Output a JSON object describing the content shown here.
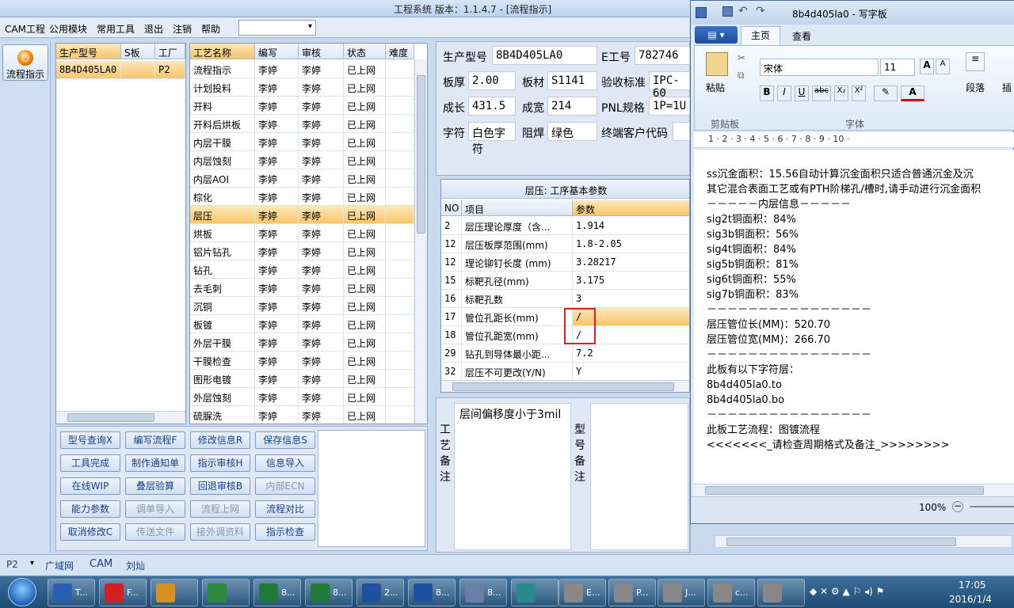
{
  "app": {
    "title": "工程系统  版本：1.1.4.7 - [流程指示]"
  },
  "menu": [
    "CAM工程",
    "公用模块",
    "常用工具",
    "退出",
    "注销",
    "帮助"
  ],
  "left_nav": {
    "button": "流程指示"
  },
  "model_grid": {
    "headers": [
      "生产型号",
      "S板",
      "工厂"
    ],
    "rows": [
      [
        "8B4D405LA0",
        "",
        "P2"
      ]
    ]
  },
  "process_grid": {
    "headers": [
      "工艺名称",
      "编写",
      "审核",
      "状态",
      "难度"
    ],
    "rows": [
      [
        "流程指示",
        "李婷",
        "李婷",
        "已上网"
      ],
      [
        "计划投料",
        "李婷",
        "李婷",
        "已上网"
      ],
      [
        "开料",
        "李婷",
        "李婷",
        "已上网"
      ],
      [
        "开料后烘板",
        "李婷",
        "李婷",
        "已上网"
      ],
      [
        "内层干膜",
        "李婷",
        "李婷",
        "已上网"
      ],
      [
        "内层蚀刻",
        "李婷",
        "李婷",
        "已上网"
      ],
      [
        "内层AOI",
        "李婷",
        "李婷",
        "已上网"
      ],
      [
        "棕化",
        "李婷",
        "李婷",
        "已上网"
      ],
      [
        "层压",
        "李婷",
        "李婷",
        "已上网"
      ],
      [
        "烘板",
        "李婷",
        "李婷",
        "已上网"
      ],
      [
        "铝片钻孔",
        "李婷",
        "李婷",
        "已上网"
      ],
      [
        "钻孔",
        "李婷",
        "李婷",
        "已上网"
      ],
      [
        "去毛刺",
        "李婷",
        "李婷",
        "已上网"
      ],
      [
        "沉铜",
        "李婷",
        "李婷",
        "已上网"
      ],
      [
        "板镀",
        "李婷",
        "李婷",
        "已上网"
      ],
      [
        "外层干膜",
        "李婷",
        "李婷",
        "已上网"
      ],
      [
        "干膜检查",
        "李婷",
        "李婷",
        "已上网"
      ],
      [
        "图形电镀",
        "李婷",
        "李婷",
        "已上网"
      ],
      [
        "外层蚀刻",
        "李婷",
        "李婷",
        "已上网"
      ],
      [
        "硫脲洗",
        "李婷",
        "李婷",
        "已上网"
      ]
    ],
    "selected": 8
  },
  "info": {
    "model_label": "生产型号",
    "model": "8B4D405LA0",
    "eno_label": "E工号",
    "eno": "782746",
    "thick_label": "板厚",
    "thick": "2.00",
    "material_label": "板材",
    "material": "S1141",
    "std_label": "验收标准",
    "std": "IPC-60",
    "len_label": "成长",
    "len": "431.5",
    "wid_label": "成宽",
    "wid": "214",
    "pnl_label": "PNL规格",
    "pnl": "1P=1U",
    "char_label": "字符",
    "char": "白色字符",
    "mask_label": "阻焊",
    "mask": "绿色",
    "cust_label": "终端客户代码",
    "cust": ""
  },
  "params": {
    "title": "层压: 工序基本参数",
    "headers": [
      "NO",
      "项目",
      "参数"
    ],
    "rows": [
      [
        "2",
        "层压理论厚度（含...",
        "1.914"
      ],
      [
        "12",
        "层压板厚范围(mm)",
        "1.8-2.05"
      ],
      [
        "12",
        "理论铆钉长度 (mm)",
        "3.28217"
      ],
      [
        "15",
        "标靶孔径(mm)",
        "3.175"
      ],
      [
        "16",
        "标靶孔数",
        "3"
      ],
      [
        "17",
        "管位孔距长(mm)",
        "/"
      ],
      [
        "18",
        "管位孔距宽(mm)",
        "/"
      ],
      [
        "29",
        "钻孔到导体最小距...",
        "7.2"
      ],
      [
        "32",
        "层压不可更改(Y/N)",
        "Y"
      ]
    ],
    "selected": 5
  },
  "remarks": {
    "process_label": "工艺备注",
    "process_text": "层间偏移度小于3mil",
    "model_label": "型号备注"
  },
  "buttons": [
    [
      "型号查询X",
      "编写流程F",
      "修改信息R",
      "保存信息S"
    ],
    [
      "工具完成",
      "制作通知单",
      "指示审核H",
      "信息导入"
    ],
    [
      "在线WIP",
      "叠层验算",
      "回退审核B",
      "内部ECN"
    ],
    [
      "能力参数",
      "调单导入",
      "流程上网",
      "流程对比"
    ],
    [
      "取消修改C",
      "传送文件",
      "接外调资料",
      "指示检查"
    ]
  ],
  "disabled_buttons": [
    "内部ECN",
    "调单导入",
    "流程上网",
    "传送文件",
    "接外调资料"
  ],
  "status": {
    "factory": "P2",
    "items": [
      "广域网",
      "CAM",
      "刘灿"
    ]
  },
  "wordpad": {
    "title": "8b4d405la0 - 写字板",
    "tabs": [
      "主页",
      "查看"
    ],
    "font": "宋体",
    "size": "11",
    "paste": "粘贴",
    "clip": "剪贴板",
    "font_group": "字体",
    "para": "段落",
    "insert": "插",
    "zoom": "100%",
    "ruler": "1 · 2 · 3 · 4 · 5 · 6 · 7 · 8 · 9 · 10 ·",
    "lines": [
      "ss沉金面积：15.56自动计算沉金面积只适合普通沉金及沉",
      "其它混合表面工艺或有PTH阶梯孔/槽时,请手动进行沉金面积",
      "－－－－－内层信息－－－－－",
      "sig2t铜面积：84%",
      "sig3b铜面积：56%",
      "sig4t铜面积：84%",
      "sig5b铜面积：81%",
      "sig6t铜面积：55%",
      "sig7b铜面积：83%",
      "－－－－－－－－－－－－－－－－",
      "层压管位长(MM)：520.70",
      "层压管位宽(MM)：266.70",
      "－－－－－－－－－－－－－－－－",
      "此板有以下字符层：",
      "8b4d405la0.to",
      "8b4d405la0.bo",
      "－－－－－－－－－－－－－－－－",
      "此板工艺流程：图镀流程",
      "<<<<<<<_请检查周期格式及备注_>>>>>>>>"
    ]
  },
  "taskbar": {
    "items": [
      "T...",
      "F...",
      "",
      "",
      "8...",
      "8...",
      "2...",
      "8...",
      "8...",
      "",
      "E...",
      "P...",
      "J...",
      "c...",
      ""
    ],
    "time": "17:05",
    "date": "2016/1/4"
  },
  "colors": {
    "accent": "#f7c66c",
    "highlight_box": "#e02020"
  }
}
